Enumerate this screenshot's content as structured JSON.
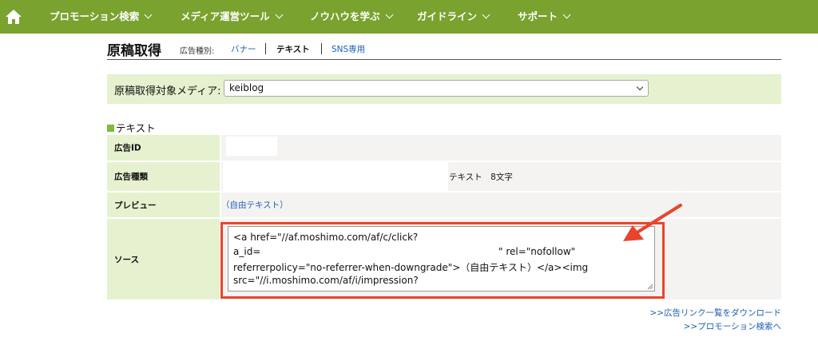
{
  "nav": {
    "home_icon": "home-icon",
    "items": [
      {
        "label": "プロモーション検索"
      },
      {
        "label": "メディア運営ツール"
      },
      {
        "label": "ノウハウを学ぶ"
      },
      {
        "label": "ガイドライン"
      },
      {
        "label": "サポート"
      }
    ],
    "bg_color": "#79a22e"
  },
  "header": {
    "title": "原稿取得",
    "ad_type_label": "広告種別:",
    "ad_types": {
      "banner": "バナー",
      "text": "テキスト",
      "sns": "SNS専用"
    },
    "active_type": "テキスト"
  },
  "media": {
    "label": "原稿取得対象メディア:",
    "selected": "keiblog"
  },
  "section": {
    "title": "テキスト"
  },
  "rows": {
    "ad_id": {
      "label": "広告ID",
      "value": ""
    },
    "ad_type": {
      "label": "広告種類",
      "value": "テキスト　8文字"
    },
    "preview": {
      "label": "プレビュー",
      "value": "（自由テキスト）"
    },
    "source": {
      "label": "ソース",
      "lines": [
        "<a href=\"//af.moshimo.com/af/c/click?",
        "a_id=",
        "\" rel=\"nofollow\"",
        "referrerpolicy=\"no-referrer-when-downgrade\">（自由テキスト）</a><img",
        "src=\"//i.moshimo.com/af/i/impression?"
      ]
    }
  },
  "links": {
    "ad_list_download": ">>広告リンク一覧をダウンロード",
    "promotion_search": ">>プロモーション検索へ"
  },
  "colors": {
    "accent_green": "#79a22e",
    "light_green": "#e6f1cf",
    "link_blue": "#1b5fb5",
    "annotation_red": "#e8452c"
  }
}
